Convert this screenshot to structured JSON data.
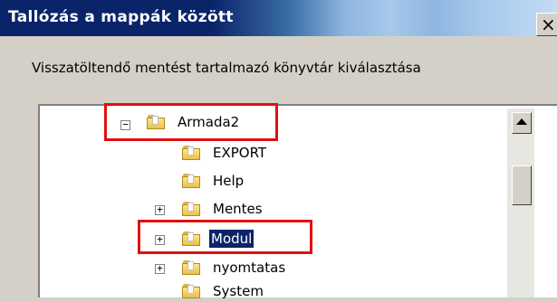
{
  "window": {
    "title": "Tallózás a mappák között",
    "close_glyph": "×"
  },
  "instruction": "Visszatöltendő mentést tartalmazó könyvtár kiválasztása",
  "tree": {
    "nodes": [
      {
        "label": "Armada2",
        "expander": "−"
      },
      {
        "label": "EXPORT",
        "expander": ""
      },
      {
        "label": "Help",
        "expander": ""
      },
      {
        "label": "Mentes",
        "expander": "+"
      },
      {
        "label": "Modul",
        "expander": "+"
      },
      {
        "label": "nyomtatas",
        "expander": "+"
      },
      {
        "label": "System",
        "expander": ""
      }
    ],
    "selected": "Modul"
  },
  "colors": {
    "highlight": "#e01010",
    "selection": "#0a246a",
    "titlebar": "#0a246a"
  }
}
